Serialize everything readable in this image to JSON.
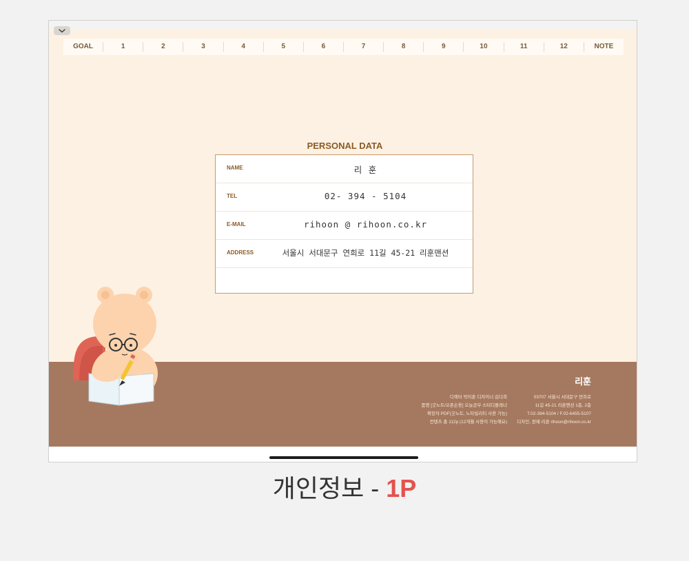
{
  "tabs": [
    "GOAL",
    "1",
    "2",
    "3",
    "4",
    "5",
    "6",
    "7",
    "8",
    "9",
    "10",
    "11",
    "12",
    "NOTE"
  ],
  "personal_data": {
    "title": "PERSONAL DATA",
    "rows": [
      {
        "label": "NAME",
        "value": "리 훈"
      },
      {
        "label": "TEL",
        "value": "02- 394  - 5104"
      },
      {
        "label": "E-MAIL",
        "value": "rihoon @ rihoon.co.kr"
      },
      {
        "label": "ADDRESS",
        "value": "서울시 서대문구 연희로 11길 45-21 리훈맨션"
      },
      {
        "label": "",
        "value": ""
      }
    ]
  },
  "footer": {
    "brand": "리훈",
    "left_lines": [
      "디렉터 박이훈 디자이너 김다희",
      "품명 [굿노트/오픈손용] 오늘공부 스터디플래너",
      "확장자 PDF(굿노트, 노타빌리티 사용 가능)",
      "컨텐츠 총 112p (12개월 사용이 가능해요)"
    ],
    "right_lines": [
      "03707 서울시 서대문구 연희로",
      "11길 45-21 리훈맨션 1층, 2층",
      "T.02-394-5104 / F.02-6455-5107",
      "디자인, 판매 리훈 rihoon@rihoon.co.kr"
    ]
  },
  "caption": {
    "text": "개인정보 - ",
    "accent": "1P"
  },
  "colors": {
    "page": "#fdf1e3",
    "desk": "#a5795f",
    "accent": "#e4524d",
    "label": "#8b5a24"
  }
}
